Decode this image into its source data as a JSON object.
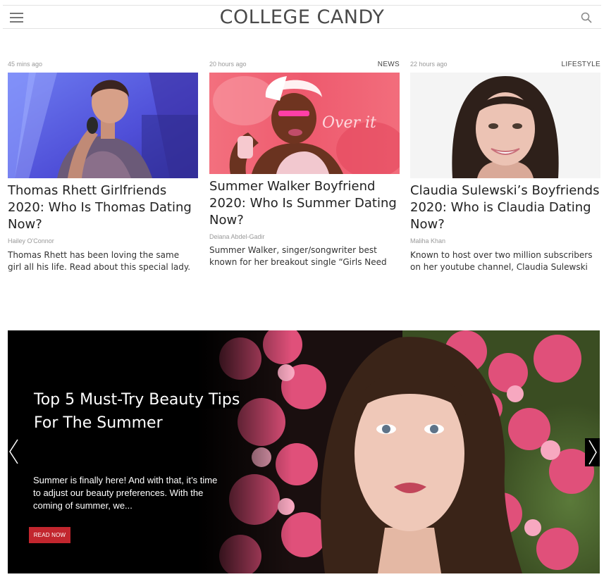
{
  "header": {
    "logo": "COLLEGE CANDY",
    "menu_icon": "hamburger-menu-icon",
    "search_icon": "search-icon"
  },
  "articles": [
    {
      "time": "45 mins ago",
      "category": "",
      "title": "Thomas Rhett Girlfriends 2020: Who Is Thomas Dating Now?",
      "author": "Hailey O'Connor",
      "excerpt": "Thomas Rhett has been loving the same girl all his life. Read about this special lady."
    },
    {
      "time": "20 hours ago",
      "category": "NEWS",
      "title": "Summer Walker Boyfriend 2020: Who Is Summer Dating Now?",
      "author": "Deiana Abdel-Gadir",
      "excerpt": "Summer Walker, singer/songwriter best known for her breakout single “Girls Need"
    },
    {
      "time": "22 hours ago",
      "category": "LIFESTYLE",
      "title": "Claudia Sulewski’s Boyfriends 2020: Who is Claudia Dating Now?",
      "author": "Maliha Khan",
      "excerpt": "Known to host over two million subscribers on her youtube channel, Claudia Sulewski"
    }
  ],
  "hero": {
    "title": "Top 5 Must-Try Beauty Tips For The Summer",
    "excerpt": "Summer is finally here! And with that, it’s time to adjust our beauty preferences. With the coming of summer, we...",
    "button": "READ NOW",
    "button_color": "#c2262e"
  }
}
